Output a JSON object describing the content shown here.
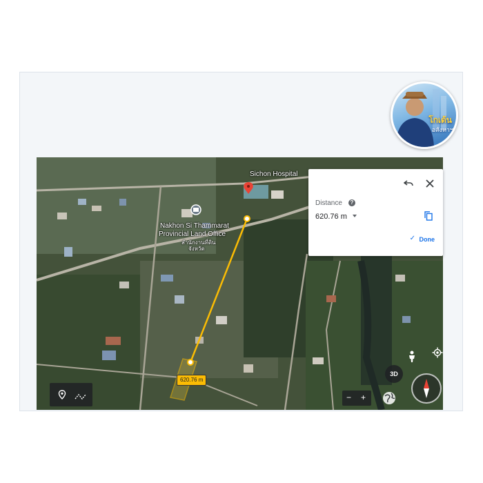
{
  "profile": {
    "name": "โกเด้น",
    "subtitle": "อสังหาฯ"
  },
  "map": {
    "labels": {
      "hospital": "Sichon Hospital",
      "land_office_line1": "Nakhon Si Thammarat",
      "land_office_line2": "Provincial Land Office",
      "land_office_thai_line1": "สำนักงานที่ดิน",
      "land_office_thai_line2": "จังหวัด"
    },
    "measurement_label": "620.76 m"
  },
  "distance_panel": {
    "title": "Distance",
    "value": "620.76 m",
    "done_label": "Done"
  },
  "controls": {
    "view_3d_label": "3D",
    "zoom_in": "+",
    "zoom_out": "−"
  },
  "colors": {
    "measure_line": "#fbbc04",
    "accent": "#1a73e8",
    "pin": "#ea4335"
  },
  "icons": {
    "undo": "undo-icon",
    "close": "close-icon",
    "help": "help-icon",
    "copy": "copy-icon",
    "check": "check-icon",
    "place": "place-icon",
    "measure": "measure-icon",
    "pegman": "pegman-icon",
    "locate": "my-location-icon",
    "globe": "globe-icon",
    "compass": "compass-icon",
    "marker": "marker-icon"
  }
}
